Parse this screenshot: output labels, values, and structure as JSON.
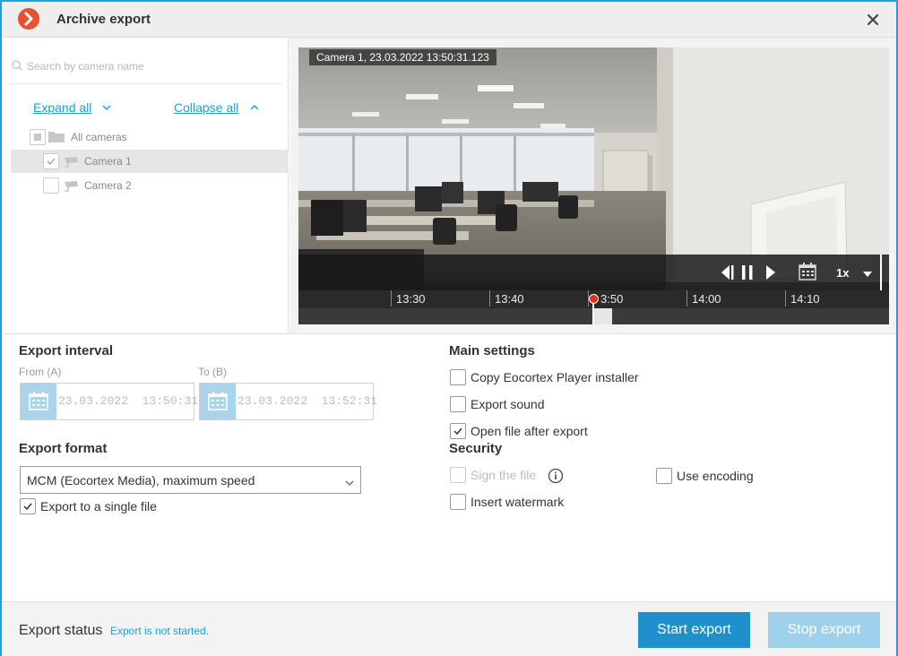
{
  "window": {
    "title": "Archive export",
    "accent_color": "#1ba1e2",
    "logo_icon": "eocortex-logo-icon",
    "close_icon": "close-icon"
  },
  "left_panel": {
    "search_placeholder": "Search by camera name",
    "expand_all": "Expand all",
    "collapse_all": "Collapse all",
    "tree": {
      "root": {
        "label": "All cameras",
        "checked": "partial"
      },
      "cameras": [
        {
          "label": "Camera 1",
          "checked": true,
          "selected": true
        },
        {
          "label": "Camera 2",
          "checked": false,
          "selected": false
        }
      ]
    }
  },
  "player": {
    "overlay": "Camera 1, 23.03.2022 13:50:31.123",
    "speed": "1x",
    "timeline_ticks": [
      "13:30",
      "13:40",
      "3:50",
      "14:00",
      "14:10"
    ]
  },
  "export_interval": {
    "title": "Export interval",
    "from_label": "From (A)",
    "from_value": "23.03.2022  13:50:31",
    "to_label": "To (B)",
    "to_value": "23.03.2022  13:52:31"
  },
  "export_format": {
    "title": "Export format",
    "selected": "MCM (Eocortex Media), maximum speed",
    "single_file_label": "Export to a single file",
    "single_file_checked": true
  },
  "main_settings": {
    "title": "Main settings",
    "options": [
      {
        "label": "Copy Eocortex Player installer",
        "checked": false
      },
      {
        "label": "Export sound",
        "checked": false
      },
      {
        "label": "Open file after export",
        "checked": true
      }
    ]
  },
  "security": {
    "title": "Security",
    "sign_file": {
      "label": "Sign the file",
      "checked": false,
      "disabled": true
    },
    "insert_watermark": {
      "label": "Insert watermark",
      "checked": false
    },
    "use_encoding": {
      "label": "Use encoding",
      "checked": false
    }
  },
  "footer": {
    "status_label": "Export status",
    "status_value": "Export is not started.",
    "start_button": "Start export",
    "stop_button": "Stop export"
  }
}
